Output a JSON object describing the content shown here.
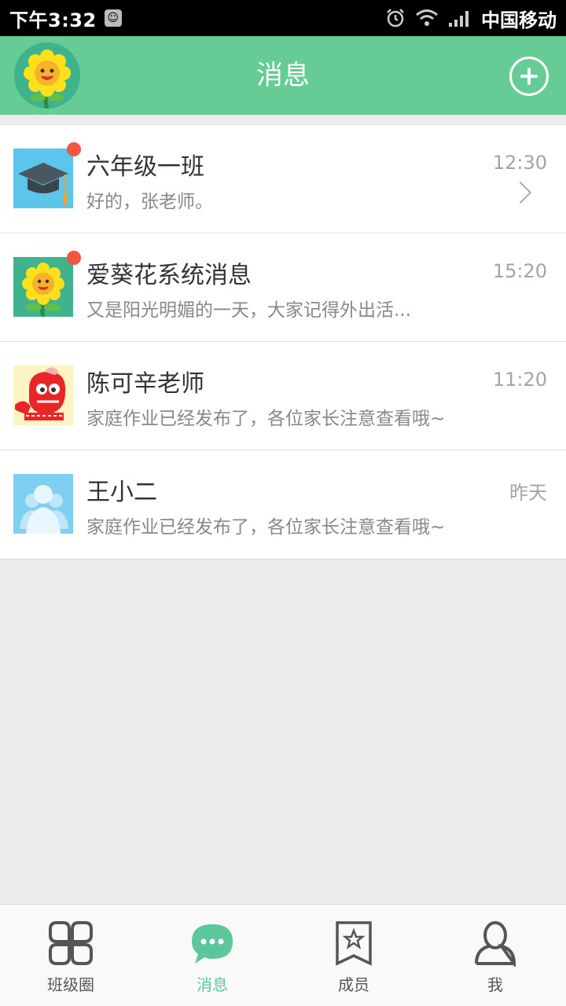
{
  "status_bar": {
    "time": "下午3:32",
    "carrier": "中国移动",
    "icons": [
      "app-notification-icon",
      "alarm-icon",
      "wifi-icon",
      "signal-icon"
    ]
  },
  "header": {
    "title": "消息",
    "avatar_icon": "sunflower-avatar-icon",
    "add_icon": "plus-circle-icon"
  },
  "colors": {
    "header_bg": "#66cc96",
    "accent": "#5cc79a",
    "unread_dot": "#f0573d"
  },
  "conversations": [
    {
      "name": "六年级一班",
      "preview": "好的，张老师。",
      "time": "12:30",
      "unread": true,
      "avatar": "graduation-cap-icon",
      "show_arrow": true
    },
    {
      "name": "爱葵花系统消息",
      "preview": "又是阳光明媚的一天，大家记得外出活...",
      "time": "15:20",
      "unread": true,
      "avatar": "sunflower-icon"
    },
    {
      "name": "陈可辛老师",
      "preview": "家庭作业已经发布了，各位家长注意查看哦~",
      "time": "11:20",
      "unread": false,
      "avatar": "red-mascot-icon"
    },
    {
      "name": "王小二",
      "preview": "家庭作业已经发布了，各位家长注意查看哦~",
      "time": "昨天",
      "unread": false,
      "avatar": "group-people-icon"
    }
  ],
  "bottom_nav": [
    {
      "label": "班级圈",
      "icon": "four-petal-grid-icon",
      "active": false
    },
    {
      "label": "消息",
      "icon": "chat-bubble-icon",
      "active": true
    },
    {
      "label": "成员",
      "icon": "star-bookmark-icon",
      "active": false
    },
    {
      "label": "我",
      "icon": "person-icon",
      "active": false
    }
  ]
}
